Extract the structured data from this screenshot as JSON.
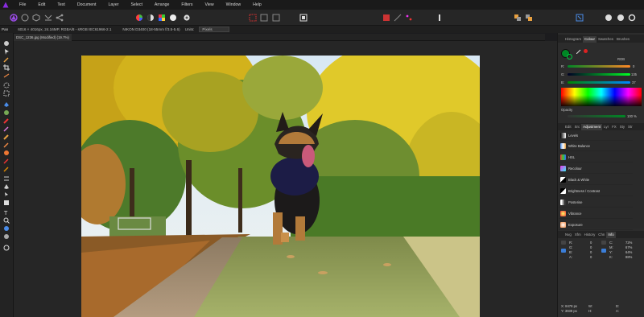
{
  "menu": [
    "File",
    "Edit",
    "Text",
    "Document",
    "Layer",
    "Select",
    "Arrange",
    "Filters",
    "View",
    "Window",
    "Help"
  ],
  "context": {
    "tool": "Pan",
    "dimensions": "6016 × 4016px, 24.16MP, RGBA/8 - sRGB IEC61966-2.1",
    "camera": "NIKON D3400 (18-55mm f/3.5-5.6)",
    "units_label": "Units:",
    "units_value": "Pixels"
  },
  "document": {
    "tab_title": "DSC_1236.jpg (Modified) (19.7%)"
  },
  "panels": {
    "top_tabs": [
      "Histogram",
      "Colour",
      "Swatches",
      "Brushes"
    ],
    "colour": {
      "mode": "RGB",
      "r_label": "R:",
      "g_label": "G:",
      "b_label": "B:",
      "r_value": "0",
      "g_value": "135",
      "b_value": "37",
      "opacity_label": "Opacity",
      "opacity_value": "100 %"
    },
    "mid_tabs": [
      "Lyr",
      "FX",
      "Sty",
      "Str"
    ],
    "mid_tab_prefix": [
      "Edit",
      "Src"
    ],
    "adjustment_tab": "Adjustment",
    "adjustments": [
      "Levels",
      "White Balance",
      "HSL",
      "Recolour",
      "Black & White",
      "Brightness / Contrast",
      "Posterise",
      "Vibrance",
      "Exposure"
    ],
    "bottom_tabs": [
      "Nvg",
      "Xfm",
      "History",
      "Chn",
      "Info"
    ],
    "info": {
      "left": {
        "r": "R:",
        "g": "G:",
        "b": "B:",
        "a": "A:",
        "r_v": "0",
        "g_v": "0",
        "b_v": "0",
        "a_v": "0"
      },
      "right": {
        "c": "C:",
        "m": "M:",
        "y": "Y:",
        "k": "K:",
        "c_v": "72%",
        "m_v": "67%",
        "y_v": "64%",
        "k_v": "88%"
      },
      "coords": {
        "x": "X: 8478 px",
        "y": "Y: 3939 px",
        "w": "W:",
        "h": "H:",
        "d": "D:",
        "a": "A:"
      }
    }
  },
  "colors": {
    "accent": "#3b7ed9",
    "primary_fill": "#008725"
  }
}
